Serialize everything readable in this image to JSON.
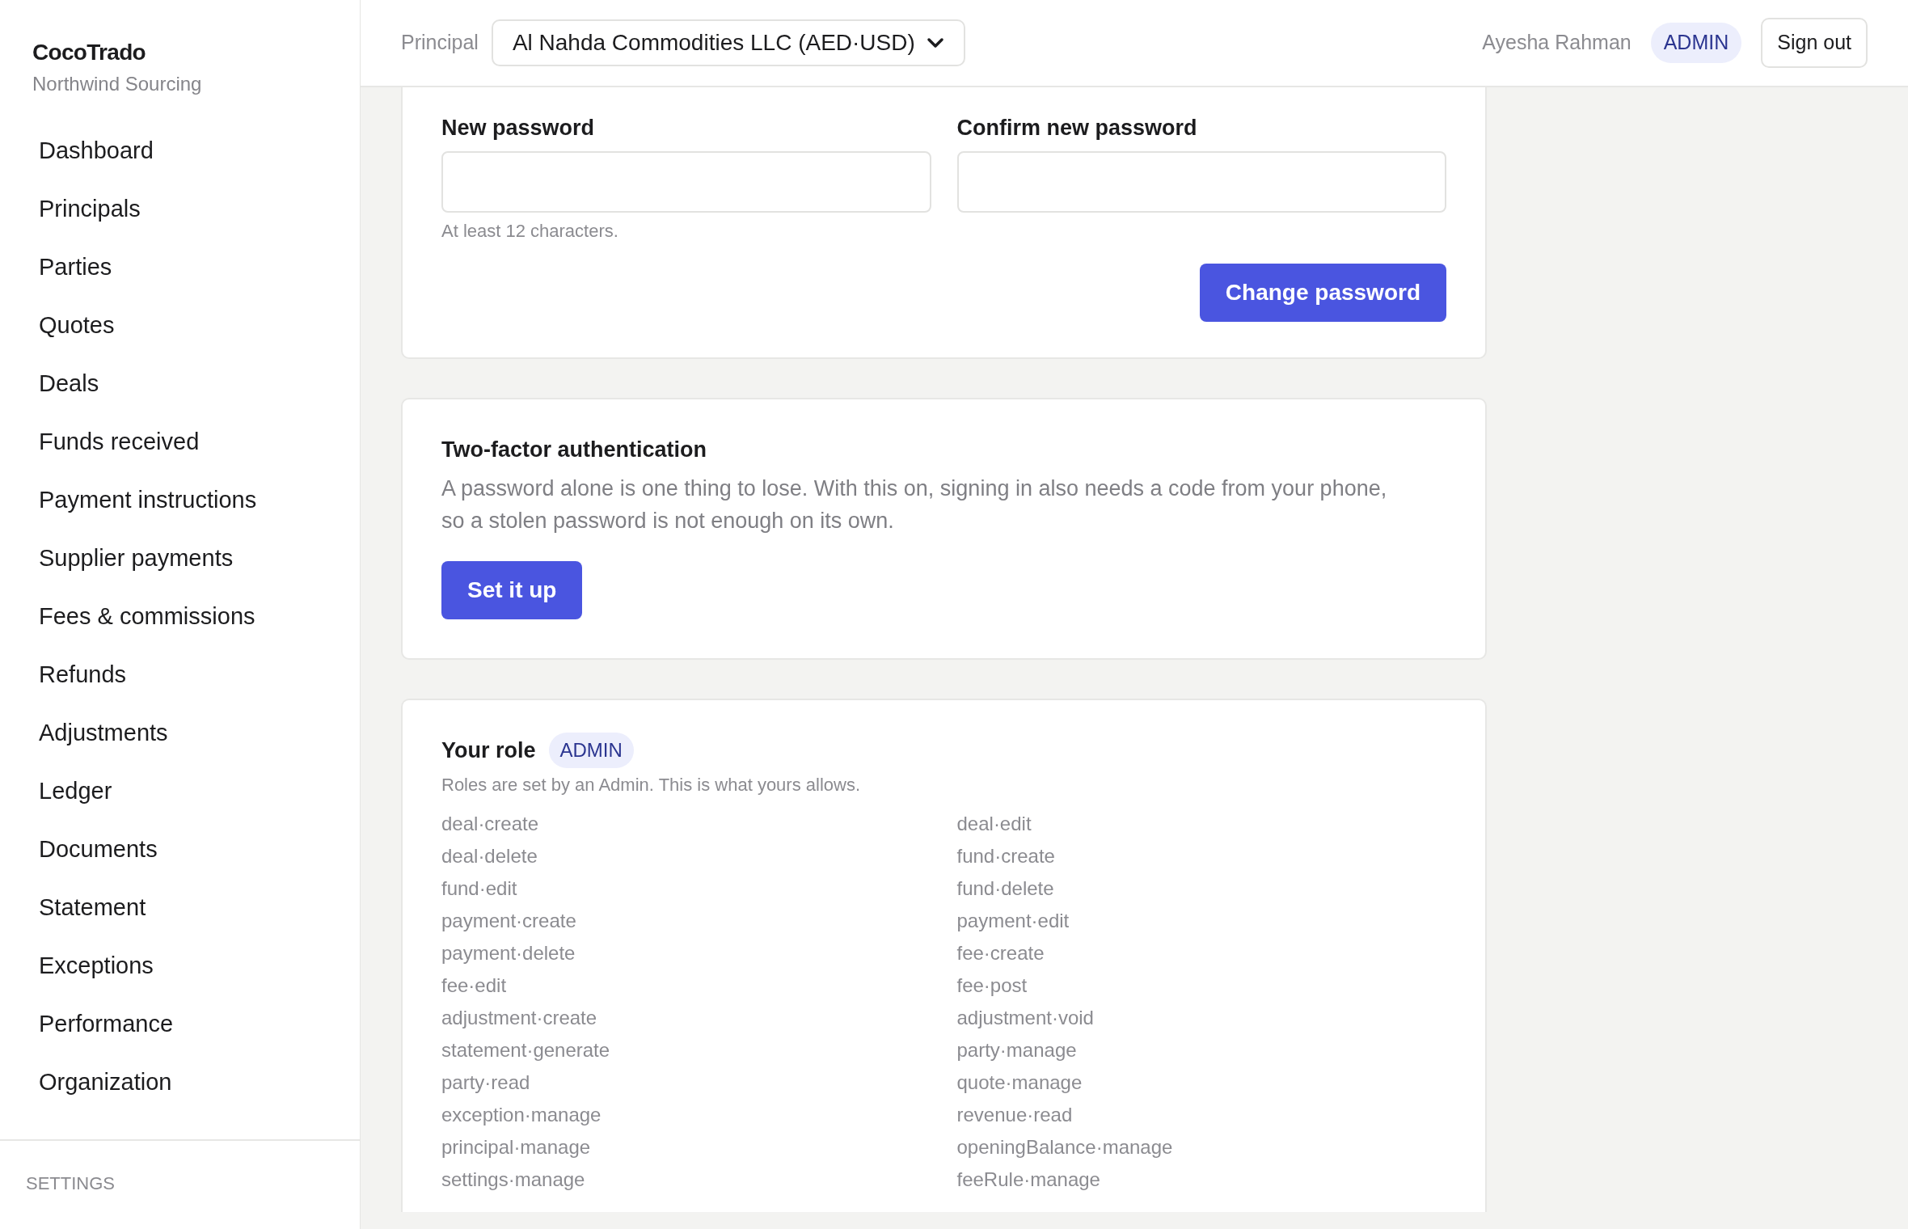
{
  "sidebar": {
    "brand": "CocoTrado",
    "org": "Northwind Sourcing",
    "items": [
      "Dashboard",
      "Principals",
      "Parties",
      "Quotes",
      "Deals",
      "Funds received",
      "Payment instructions",
      "Supplier payments",
      "Fees & commissions",
      "Refunds",
      "Adjustments",
      "Ledger",
      "Documents",
      "Statement",
      "Exceptions",
      "Performance",
      "Organization"
    ],
    "section": "SETTINGS"
  },
  "header": {
    "principal_label": "Principal",
    "principal_value": "Al Nahda Commodities LLC (AED·USD)",
    "user": "Ayesha Rahman",
    "role": "ADMIN",
    "sign_out": "Sign out"
  },
  "password_card": {
    "new_label": "New password",
    "confirm_label": "Confirm new password",
    "hint": "At least 12 characters.",
    "button": "Change password"
  },
  "two_factor": {
    "title": "Two-factor authentication",
    "text": "A password alone is one thing to lose. With this on, signing in also needs a code from your phone, so a stolen password is not enough on its own.",
    "button": "Set it up"
  },
  "role": {
    "title": "Your role",
    "badge": "ADMIN",
    "text": "Roles are set by an Admin. This is what yours allows.",
    "permissions": [
      "deal·create",
      "deal·edit",
      "deal·delete",
      "fund·create",
      "fund·edit",
      "fund·delete",
      "payment·create",
      "payment·edit",
      "payment·delete",
      "fee·create",
      "fee·edit",
      "fee·post",
      "adjustment·create",
      "adjustment·void",
      "statement·generate",
      "party·manage",
      "party·read",
      "quote·manage",
      "exception·manage",
      "revenue·read",
      "principal·manage",
      "openingBalance·manage",
      "settings·manage",
      "feeRule·manage"
    ]
  }
}
